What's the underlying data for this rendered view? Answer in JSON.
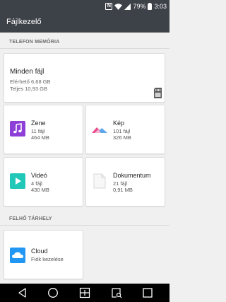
{
  "status_bar": {
    "nfc": "N",
    "battery_percent": "79%",
    "time": "3:03"
  },
  "app": {
    "title": "Fájlkezelő"
  },
  "sections": {
    "phone_memory": "TELEFON MEMÓRIA",
    "cloud_storage": "FELHŐ TÁRHELY"
  },
  "all_files": {
    "title": "Minden fájl",
    "available": "Elérhető 6,68 GB",
    "total": "Teljes 10,93 GB"
  },
  "tiles": [
    {
      "title": "Zene",
      "count": "11 fájl",
      "size": "464 MB",
      "icon": "music-icon",
      "color": "#8e3fd8"
    },
    {
      "title": "Kép",
      "count": "101 fájl",
      "size": "326 MB",
      "icon": "image-icon",
      "color": "#e94b8a"
    },
    {
      "title": "Videó",
      "count": "4 fájl",
      "size": "430 MB",
      "icon": "video-icon",
      "color": "#21c7b7"
    },
    {
      "title": "Dokumentum",
      "count": "21 fájl",
      "size": "0,91 MB",
      "icon": "document-icon",
      "color": "#eeeeee"
    }
  ],
  "cloud": {
    "title": "Cloud",
    "subtitle": "Fiók kezelése",
    "icon": "cloud-icon",
    "color": "#2196f3"
  },
  "nav": [
    "back-icon",
    "home-icon",
    "dual-window-icon",
    "notification-search-icon",
    "recent-apps-icon"
  ]
}
